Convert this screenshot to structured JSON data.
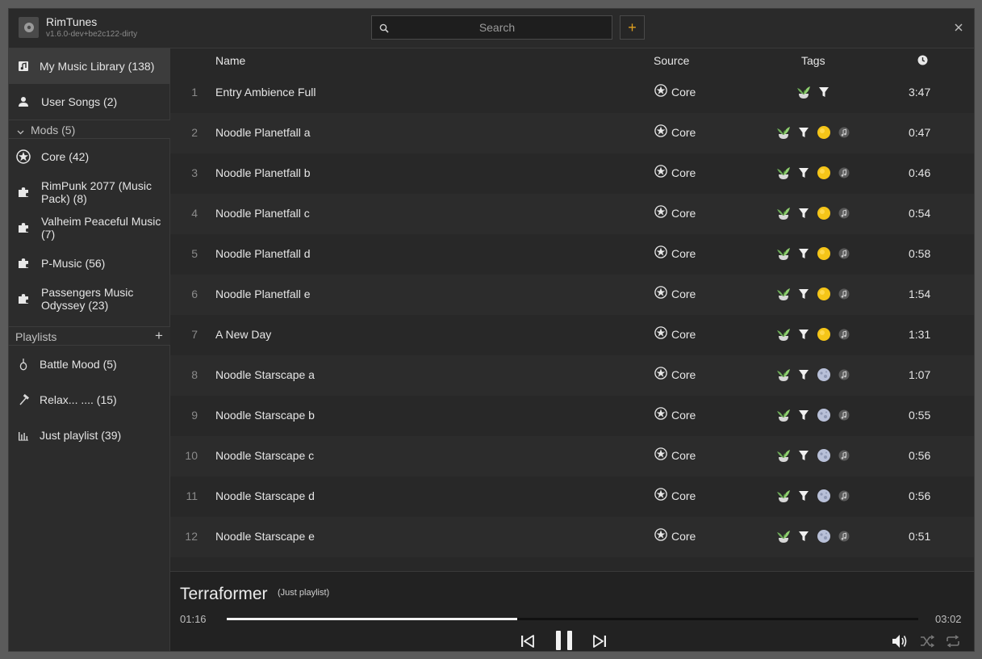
{
  "app": {
    "title": "RimTunes",
    "version": "v1.6.0-dev+be2c122-dirty"
  },
  "search": {
    "placeholder": "Search"
  },
  "header": {
    "add_label": "+"
  },
  "sidebar": {
    "library": [
      {
        "label": "My Music Library (138)",
        "icon": "music-library-icon"
      },
      {
        "label": "User Songs (2)",
        "icon": "user-icon"
      }
    ],
    "mods_header": "Mods (5)",
    "mods": [
      {
        "label": "Core (42)",
        "icon": "rimworld-core-icon"
      },
      {
        "label": "RimPunk 2077 (Music Pack) (8)",
        "icon": "puzzle-icon"
      },
      {
        "label": "Valheim Peaceful Music (7)",
        "icon": "puzzle-icon"
      },
      {
        "label": "P-Music (56)",
        "icon": "puzzle-icon"
      },
      {
        "label": "Passengers Music Odyssey  (23)",
        "icon": "puzzle-icon"
      }
    ],
    "playlists_header": "Playlists",
    "playlists_add": "+",
    "playlists": [
      {
        "label": "Battle Mood (5)",
        "icon": "grenade-icon"
      },
      {
        "label": "Relax... .... (15)",
        "icon": "hammer-icon"
      },
      {
        "label": "Just playlist (39)",
        "icon": "bar-chart-icon"
      }
    ]
  },
  "table": {
    "columns": {
      "name": "Name",
      "source": "Source",
      "tags": "Tags"
    },
    "rows": [
      {
        "num": "1",
        "name": "Entry Ambience Full",
        "source": "Core",
        "tags": [
          "plant-icon",
          "filter-icon"
        ],
        "duration": "3:47"
      },
      {
        "num": "2",
        "name": "Noodle Planetfall a",
        "source": "Core",
        "tags": [
          "plant-icon",
          "filter-icon",
          "sun-icon",
          "music-note-icon"
        ],
        "duration": "0:47"
      },
      {
        "num": "3",
        "name": "Noodle Planetfall b",
        "source": "Core",
        "tags": [
          "plant-icon",
          "filter-icon",
          "sun-icon",
          "music-note-icon"
        ],
        "duration": "0:46"
      },
      {
        "num": "4",
        "name": "Noodle Planetfall c",
        "source": "Core",
        "tags": [
          "plant-icon",
          "filter-icon",
          "sun-icon",
          "music-note-icon"
        ],
        "duration": "0:54"
      },
      {
        "num": "5",
        "name": "Noodle Planetfall d",
        "source": "Core",
        "tags": [
          "plant-icon",
          "filter-icon",
          "sun-icon",
          "music-note-icon"
        ],
        "duration": "0:58"
      },
      {
        "num": "6",
        "name": "Noodle Planetfall e",
        "source": "Core",
        "tags": [
          "plant-icon",
          "filter-icon",
          "sun-icon",
          "music-note-icon"
        ],
        "duration": "1:54"
      },
      {
        "num": "7",
        "name": "A New Day",
        "source": "Core",
        "tags": [
          "plant-icon",
          "filter-icon",
          "sun-icon",
          "music-note-icon"
        ],
        "duration": "1:31"
      },
      {
        "num": "8",
        "name": "Noodle Starscape a",
        "source": "Core",
        "tags": [
          "plant-icon",
          "filter-icon",
          "moon-icon",
          "music-note-icon"
        ],
        "duration": "1:07"
      },
      {
        "num": "9",
        "name": "Noodle Starscape b",
        "source": "Core",
        "tags": [
          "plant-icon",
          "filter-icon",
          "moon-icon",
          "music-note-icon"
        ],
        "duration": "0:55"
      },
      {
        "num": "10",
        "name": "Noodle Starscape c",
        "source": "Core",
        "tags": [
          "plant-icon",
          "filter-icon",
          "moon-icon",
          "music-note-icon"
        ],
        "duration": "0:56"
      },
      {
        "num": "11",
        "name": "Noodle Starscape d",
        "source": "Core",
        "tags": [
          "plant-icon",
          "filter-icon",
          "moon-icon",
          "music-note-icon"
        ],
        "duration": "0:56"
      },
      {
        "num": "12",
        "name": "Noodle Starscape e",
        "source": "Core",
        "tags": [
          "plant-icon",
          "filter-icon",
          "moon-icon",
          "music-note-icon"
        ],
        "duration": "0:51"
      }
    ]
  },
  "player": {
    "title": "Terraformer",
    "playlist": "(Just playlist)",
    "current_time": "01:16",
    "total_time": "03:02",
    "progress": 0.42
  },
  "colors": {
    "accent": "#e0a020",
    "sun": "#f5c518",
    "moon": "#b8c0d8"
  }
}
